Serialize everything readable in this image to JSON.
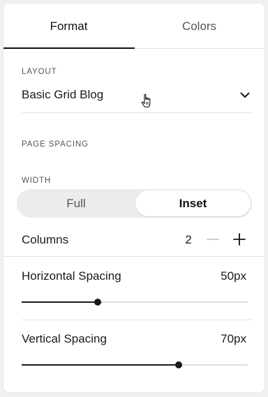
{
  "tabs": {
    "format": "Format",
    "colors": "Colors"
  },
  "layout": {
    "label": "LAYOUT",
    "value": "Basic Grid Blog"
  },
  "page_spacing": {
    "label": "PAGE SPACING"
  },
  "width": {
    "label": "WIDTH",
    "options": [
      "Full",
      "Inset"
    ],
    "selected": "Inset"
  },
  "columns": {
    "label": "Columns",
    "value": "2"
  },
  "horizontal_spacing": {
    "label": "Horizontal Spacing",
    "value": "50px",
    "level": 0.335
  },
  "vertical_spacing": {
    "label": "Vertical Spacing",
    "value": "70px",
    "level": 0.694
  },
  "colors": {
    "accent": "#1a1a1a",
    "track": "#dcdcdc",
    "segment_bg": "#ececec"
  }
}
